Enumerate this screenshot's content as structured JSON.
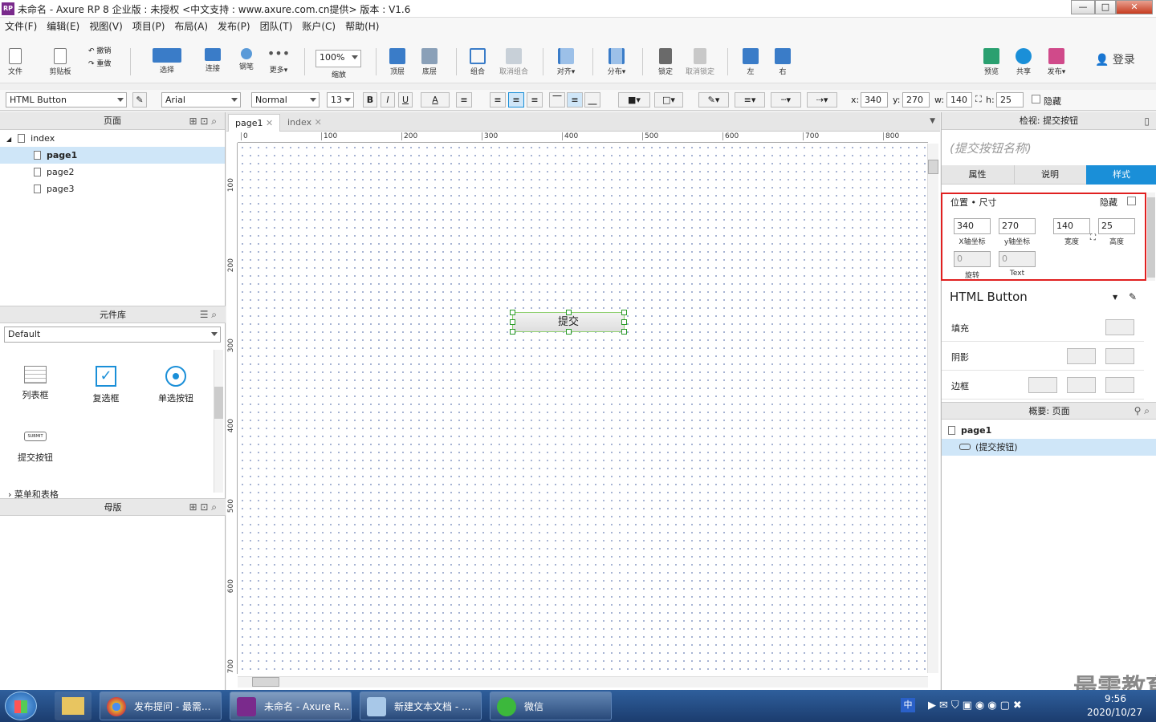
{
  "window": {
    "title": "未命名 - Axure RP 8 企业版 : 未授权    <中文支持 : www.axure.com.cn提供> 版本 : V1.6",
    "minimize": "—",
    "maximize": "□",
    "close": "✕"
  },
  "menu": [
    "文件(F)",
    "编辑(E)",
    "视图(V)",
    "项目(P)",
    "布局(A)",
    "发布(P)",
    "团队(T)",
    "账户(C)",
    "帮助(H)"
  ],
  "toolbar": {
    "file": "文件",
    "clipboard": "剪贴板",
    "undo": "撤销",
    "redo": "重做",
    "select": "选择",
    "connect": "连接",
    "pen": "钢笔",
    "more": "更多▾",
    "zoom_value": "100%",
    "zoom_label": "缩放",
    "top": "顶层",
    "bottom": "底层",
    "group": "组合",
    "ungroup": "取消组合",
    "align": "对齐▾",
    "distribute": "分布▾",
    "lock": "锁定",
    "unlock": "取消锁定",
    "left": "左",
    "right": "右",
    "preview": "预览",
    "share": "共享",
    "publish": "发布▾",
    "login": "登录"
  },
  "format": {
    "widget_type": "HTML Button",
    "font": "Arial",
    "style": "Normal",
    "size": "13",
    "bold": "B",
    "italic": "I",
    "underline": "U",
    "font_color": "A",
    "x_label": "x:",
    "x": "340",
    "y_label": "y:",
    "y": "270",
    "w_label": "w:",
    "w": "140",
    "h_label": "h:",
    "h": "25",
    "hidden": "隐藏"
  },
  "pages": {
    "title": "页面",
    "items": [
      "index",
      "page1",
      "page2",
      "page3"
    ],
    "selected": "page1"
  },
  "library": {
    "title": "元件库",
    "selected": "Default",
    "widgets": [
      "列表框",
      "复选框",
      "单选按钮",
      "提交按钮"
    ],
    "submit_icon_text": "SUBMIT",
    "section": "菜单和表格"
  },
  "masters": {
    "title": "母版"
  },
  "tabs": [
    "page1",
    "index"
  ],
  "ruler": {
    "h": [
      "0",
      "100",
      "200",
      "300",
      "400",
      "500",
      "600",
      "700",
      "800"
    ],
    "v": [
      "100",
      "200",
      "300",
      "400",
      "500",
      "600",
      "700"
    ]
  },
  "canvas": {
    "button_label": "提交"
  },
  "inspector": {
    "title": "检视: 提交按钮",
    "name_placeholder": "(提交按钮名称)",
    "tabs": [
      "属性",
      "说明",
      "样式"
    ],
    "position_title": "位置 • 尺寸",
    "hidden": "隐藏",
    "x": "340",
    "x_label": "X轴坐标",
    "y": "270",
    "y_label": "y轴坐标",
    "w": "140",
    "w_label": "宽度",
    "h": "25",
    "h_label": "高度",
    "rotate": "0",
    "rotate_label": "旋转",
    "text_rotate": "0",
    "text_rotate_label": "Text",
    "style_name": "HTML Button",
    "fill": "填充",
    "shadow": "阴影",
    "border": "边框"
  },
  "outline": {
    "title": "概要: 页面",
    "page": "page1",
    "item": "(提交按钮)"
  },
  "taskbar": {
    "items": [
      "发布提问 - 最需...",
      "未命名 - Axure R...",
      "新建文本文档 - ...",
      "微信"
    ],
    "time": "9:56",
    "date": "2020/10/27",
    "ime": "中",
    "watermark": "最需教育"
  },
  "colors": {
    "accent": "#1a8fd8",
    "highlight": "#e02020"
  }
}
